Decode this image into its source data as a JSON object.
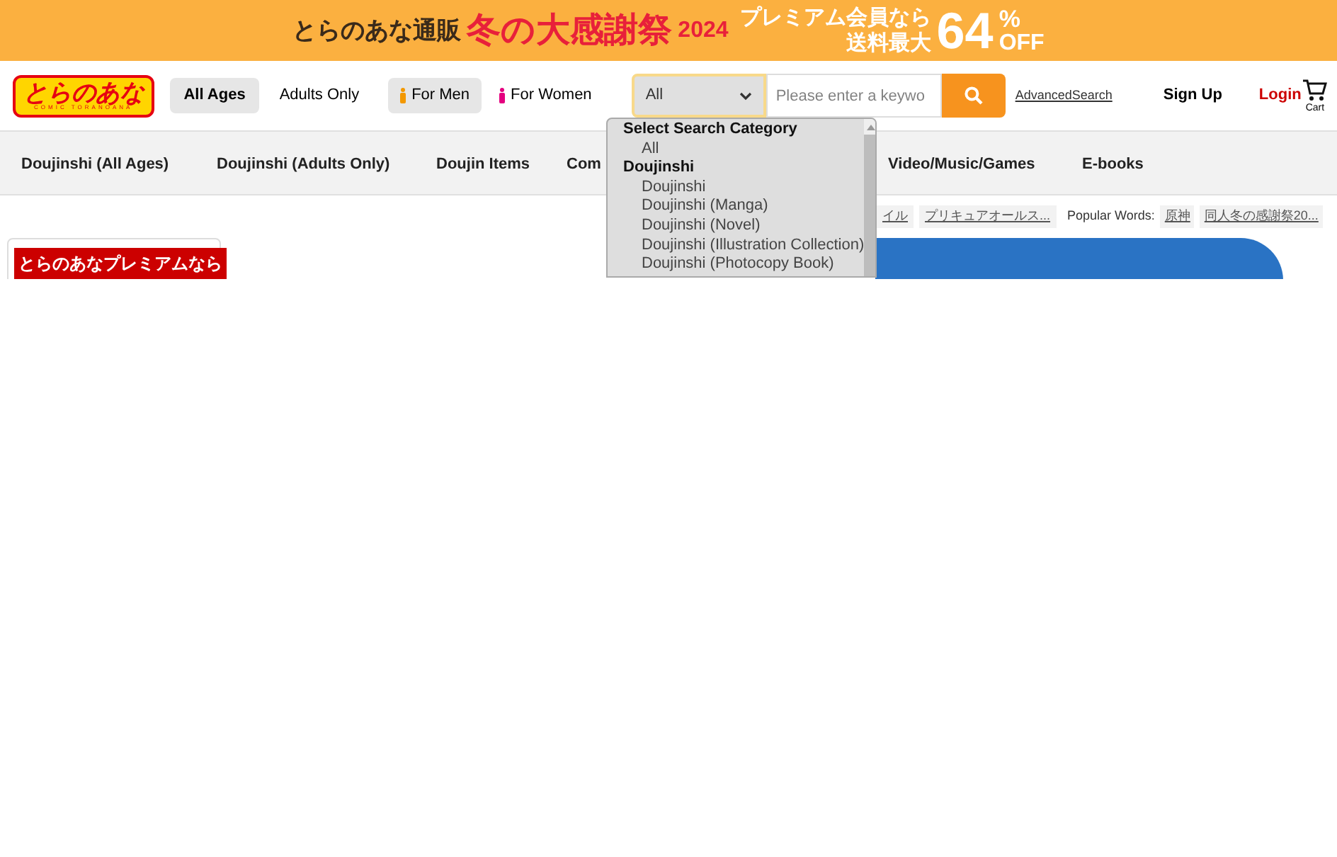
{
  "banner": {
    "shop_name": "とらのあな通販",
    "event": "冬の大感謝祭",
    "year": "2024",
    "offer_line_1": "プレミアム会員なら",
    "offer_line_2": "送料最大",
    "discount": "64",
    "percent": "%",
    "off": "OFF"
  },
  "header": {
    "logo": "とらのあな",
    "logo_sub": "COMIC TORANOANA",
    "age_tabs": [
      {
        "label": "All Ages",
        "selected": true
      },
      {
        "label": "Adults Only",
        "selected": false
      }
    ],
    "gender_tabs": [
      {
        "label": "For Men",
        "selected": true,
        "color": "#f39800"
      },
      {
        "label": "For Women",
        "selected": false,
        "color": "#e4007f"
      }
    ],
    "search": {
      "category": "All",
      "placeholder": "Please enter a keywo"
    },
    "advanced_search": "AdvancedSearch",
    "sign_up": "Sign Up",
    "login": "Login",
    "cart": "Cart"
  },
  "nav": [
    "Doujinshi (All Ages)",
    "Doujinshi (Adults Only)",
    "Doujin Items",
    "Com",
    "Video/Music/Games",
    "E-books"
  ],
  "category_dropdown": {
    "heading": "Select Search Category",
    "options": [
      {
        "label": "All",
        "kind": "option"
      },
      {
        "label": "Doujinshi",
        "kind": "group"
      },
      {
        "label": "Doujinshi",
        "kind": "option"
      },
      {
        "label": "Doujinshi (Manga)",
        "kind": "option"
      },
      {
        "label": "Doujinshi (Novel)",
        "kind": "option"
      },
      {
        "label": "Doujinshi (Illustration Collection)",
        "kind": "option"
      },
      {
        "label": "Doujinshi (Photocopy Book)",
        "kind": "option"
      }
    ]
  },
  "trending_tags": [
    "イル",
    "プリキュアオールス..."
  ],
  "popular_label": "Popular Words:",
  "popular_words": [
    "原神",
    "同人冬の感謝祭20..."
  ],
  "premium_card": {
    "label": "とらのあなプレミアムなら"
  }
}
